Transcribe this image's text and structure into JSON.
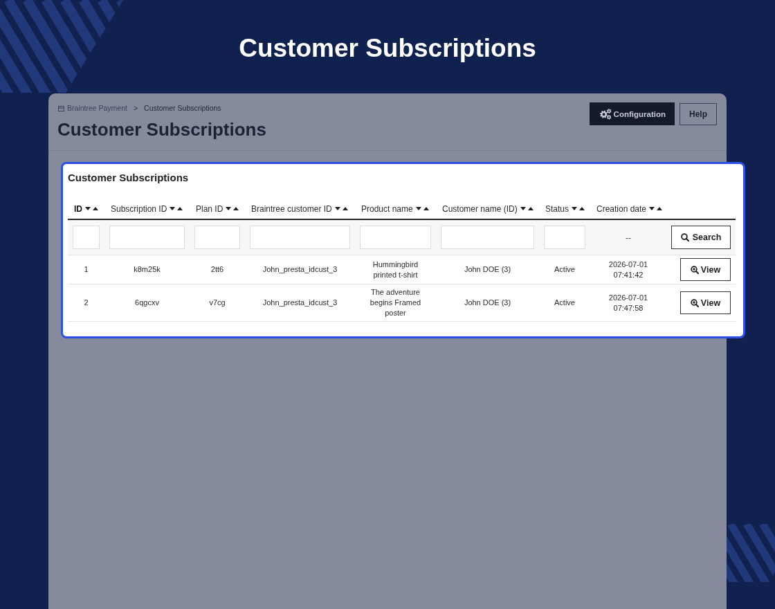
{
  "page_title": "Customer Subscriptions",
  "panel": {
    "breadcrumb": {
      "items": [
        {
          "label": "Braintree Payment",
          "kind": "link"
        },
        {
          "label": "Customer Subscriptions",
          "kind": "current"
        }
      ],
      "separator": ">"
    },
    "heading": "Customer Subscriptions",
    "toolbar": [
      {
        "label": "Configuration",
        "kind": "primary"
      },
      {
        "label": "Help",
        "kind": "outline"
      }
    ]
  },
  "card": {
    "title": "Customer Subscriptions",
    "columns": [
      {
        "label": "ID",
        "sorted": true
      },
      {
        "label": "Subscription ID",
        "sorted": false
      },
      {
        "label": "Plan ID",
        "sorted": false
      },
      {
        "label": "Braintree customer ID",
        "sorted": false
      },
      {
        "label": "Product name",
        "sorted": false
      },
      {
        "label": "Customer name (ID)",
        "sorted": false
      },
      {
        "label": "Status",
        "sorted": false
      },
      {
        "label": "Creation date",
        "sorted": false
      }
    ],
    "filters": [
      {
        "kind": "field"
      },
      {
        "kind": "field"
      },
      {
        "kind": "field"
      },
      {
        "kind": "field"
      },
      {
        "kind": "field"
      },
      {
        "kind": "field"
      },
      {
        "kind": "field"
      },
      {
        "kind": "text",
        "text": "--"
      }
    ],
    "search_button": "Search",
    "rows": [
      {
        "cells": [
          "1",
          "k8m25k",
          "2tt6",
          "John_presta_idcust_3",
          "Hummingbird printed t-shirt",
          "John DOE (3)",
          "Active",
          "2026-07-01 07:41:42"
        ],
        "action": "View"
      },
      {
        "cells": [
          "2",
          "6qgcxv",
          "v7cg",
          "John_presta_idcust_3",
          "The adventure begins Framed poster",
          "John DOE (3)",
          "Active",
          "2026-07-01 07:47:58"
        ],
        "action": "View"
      }
    ]
  }
}
